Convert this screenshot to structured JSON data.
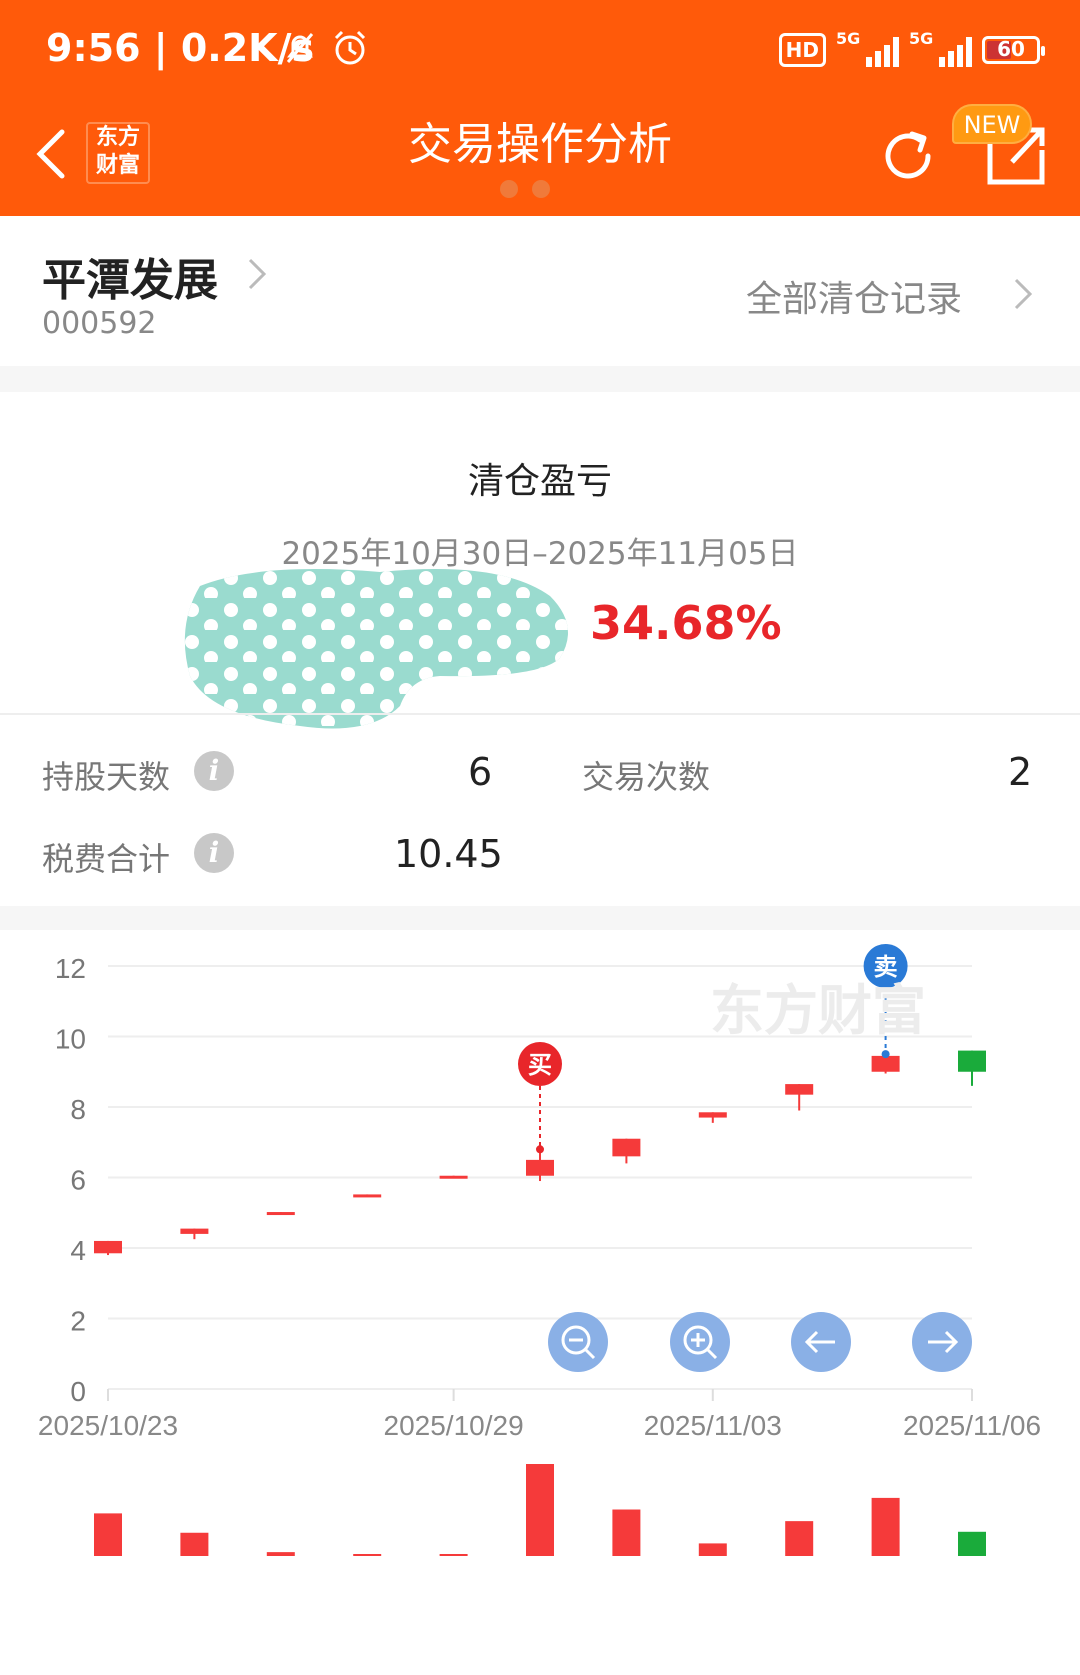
{
  "status_bar": {
    "time": "9:56 | 0.2K/s",
    "hd_label": "HD",
    "net1": "5G",
    "net2": "5G",
    "battery": "60"
  },
  "header": {
    "title": "交易操作分析",
    "logo_text": "东方财富",
    "new_badge": "NEW",
    "accent_color": "#ff5a0a"
  },
  "stock": {
    "name": "平潭发展",
    "code": "000592",
    "all_records_label": "全部清仓记录"
  },
  "summary": {
    "title": "清仓盈亏",
    "date_range": "2025年10月30日–2025年11月05日",
    "profit_pct": "34.68%",
    "profit_color": "#e8262a"
  },
  "stats": {
    "holding_days_label": "持股天数",
    "holding_days_value": "6",
    "trade_count_label": "交易次数",
    "trade_count_value": "2",
    "fees_label": "税费合计",
    "fees_value": "10.45"
  },
  "chart_data": {
    "type": "candlestick",
    "watermark": "东方财富",
    "ylim": [
      0,
      12
    ],
    "yticks": [
      0,
      2,
      4,
      6,
      8,
      10,
      12
    ],
    "xlabels": [
      "2025/10/23",
      "2025/10/29",
      "2025/11/03",
      "2025/11/06"
    ],
    "xlabel_indices": [
      0,
      4,
      7,
      10
    ],
    "candles": [
      {
        "open": 3.85,
        "close": 4.2,
        "high": 4.2,
        "low": 3.8
      },
      {
        "open": 4.4,
        "close": 4.55,
        "high": 4.55,
        "low": 4.25
      },
      {
        "open": 4.97,
        "close": 5.02,
        "high": 5.02,
        "low": 4.97
      },
      {
        "open": 5.47,
        "close": 5.52,
        "high": 5.52,
        "low": 5.47
      },
      {
        "open": 6.0,
        "close": 6.05,
        "high": 6.05,
        "low": 6.0
      },
      {
        "open": 6.05,
        "close": 6.5,
        "high": 6.8,
        "low": 5.9
      },
      {
        "open": 6.6,
        "close": 7.1,
        "high": 7.1,
        "low": 6.4
      },
      {
        "open": 7.7,
        "close": 7.85,
        "high": 7.85,
        "low": 7.55
      },
      {
        "open": 8.35,
        "close": 8.65,
        "high": 8.65,
        "low": 7.9
      },
      {
        "open": 9.0,
        "close": 9.45,
        "high": 9.5,
        "low": 8.95
      },
      {
        "open": 9.6,
        "close": 9.0,
        "high": 9.6,
        "low": 8.6
      }
    ],
    "volumes": [
      44,
      24,
      4,
      1,
      2,
      95,
      48,
      13,
      36,
      60,
      25
    ],
    "markers": [
      {
        "label": "买",
        "index": 5,
        "price": 6.8,
        "color": "#e8262a"
      },
      {
        "label": "卖",
        "index": 9,
        "price": 9.5,
        "color": "#2a7ad6"
      }
    ],
    "up_color": "#f53a3a",
    "down_color": "#1aab3b"
  },
  "controls": {
    "zoom_out": "zoom-out",
    "zoom_in": "zoom-in",
    "prev": "arrow-left",
    "next": "arrow-right"
  }
}
